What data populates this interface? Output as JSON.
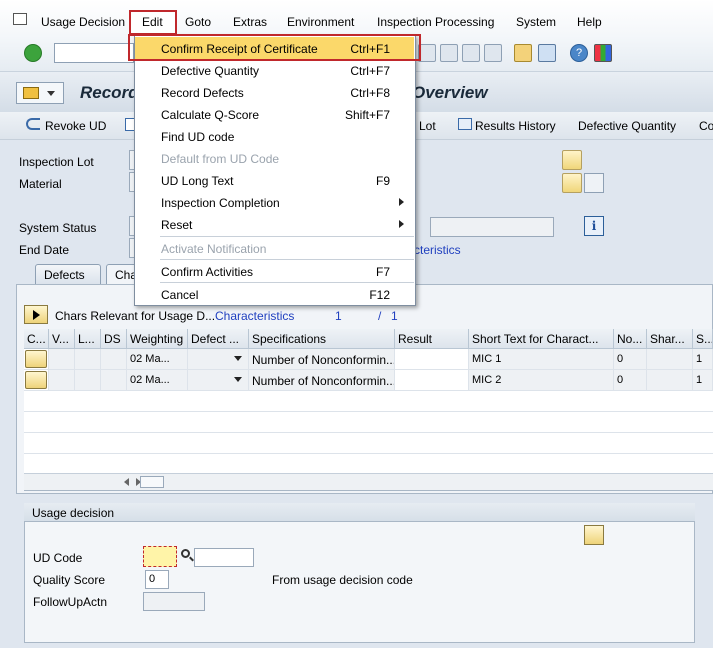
{
  "menubar": {
    "items": [
      "Usage Decision",
      "Edit",
      "Goto",
      "Extras",
      "Environment",
      "Inspection Processing",
      "System",
      "Help"
    ]
  },
  "title": {
    "left": "Record",
    "right": "Overview"
  },
  "app_toolbar": {
    "revoke": "Revoke UD",
    "lot": "Lot",
    "results_history": "Results History",
    "defective_quantity": "Defective Quantity",
    "more": "Co"
  },
  "header": {
    "inspection_lot_label": "Inspection Lot",
    "material_label": "Material",
    "system_status_label": "System Status",
    "end_date_label": "End Date",
    "characteristics_link": "cteristics"
  },
  "tabs": [
    "Defects",
    "Cha"
  ],
  "chars_section": {
    "label": "Chars Relevant for Usage D...",
    "link": "Characteristics",
    "page_current": "1",
    "page_sep": "/",
    "page_total": "1"
  },
  "table": {
    "columns": [
      "C...",
      "V...",
      "L...",
      "DS",
      "Weighting",
      "Defect ...",
      "Specifications",
      "Result",
      "Short Text for Charact...",
      "No...",
      "Shar...",
      "S..."
    ],
    "rows": [
      {
        "weighting": "02 Ma...",
        "specifications": "Number of Nonconformin...",
        "short_text": "MIC 1",
        "no": "0",
        "s": "1"
      },
      {
        "weighting": "02 Ma...",
        "specifications": "Number of Nonconformin...",
        "short_text": "MIC 2",
        "no": "0",
        "s": "1"
      }
    ]
  },
  "usage_decision": {
    "group_title": "Usage decision",
    "ud_code_label": "UD Code",
    "quality_score_label": "Quality Score",
    "quality_score_value": "0",
    "followup_label": "FollowUpActn",
    "from_ud_text": "From usage decision code"
  },
  "edit_menu": {
    "items": [
      {
        "label": "Confirm Receipt of Certificate",
        "shortcut": "Ctrl+F1",
        "disabled": false,
        "submenu": false
      },
      {
        "label": "Defective Quantity",
        "shortcut": "Ctrl+F7",
        "disabled": false,
        "submenu": false
      },
      {
        "label": "Record Defects",
        "shortcut": "Ctrl+F8",
        "disabled": false,
        "submenu": false
      },
      {
        "label": "Calculate Q-Score",
        "shortcut": "Shift+F7",
        "disabled": false,
        "submenu": false
      },
      {
        "label": "Find UD code",
        "shortcut": "",
        "disabled": false,
        "submenu": false
      },
      {
        "label": "Default from UD Code",
        "shortcut": "",
        "disabled": true,
        "submenu": false
      },
      {
        "label": "UD Long Text",
        "shortcut": "F9",
        "disabled": false,
        "submenu": false
      },
      {
        "label": "Inspection Completion",
        "shortcut": "",
        "disabled": false,
        "submenu": true
      },
      {
        "label": "Reset",
        "shortcut": "",
        "disabled": false,
        "submenu": true
      },
      {
        "label": "Activate Notification",
        "shortcut": "",
        "disabled": true,
        "submenu": false
      },
      {
        "label": "Confirm Activities",
        "shortcut": "F7",
        "disabled": false,
        "submenu": false
      },
      {
        "label": "Cancel",
        "shortcut": "F12",
        "disabled": false,
        "submenu": false
      }
    ]
  },
  "colors": {
    "highlight": "#fbd86a",
    "callout_red": "#c0282c",
    "link_blue": "#1f3fbf"
  }
}
